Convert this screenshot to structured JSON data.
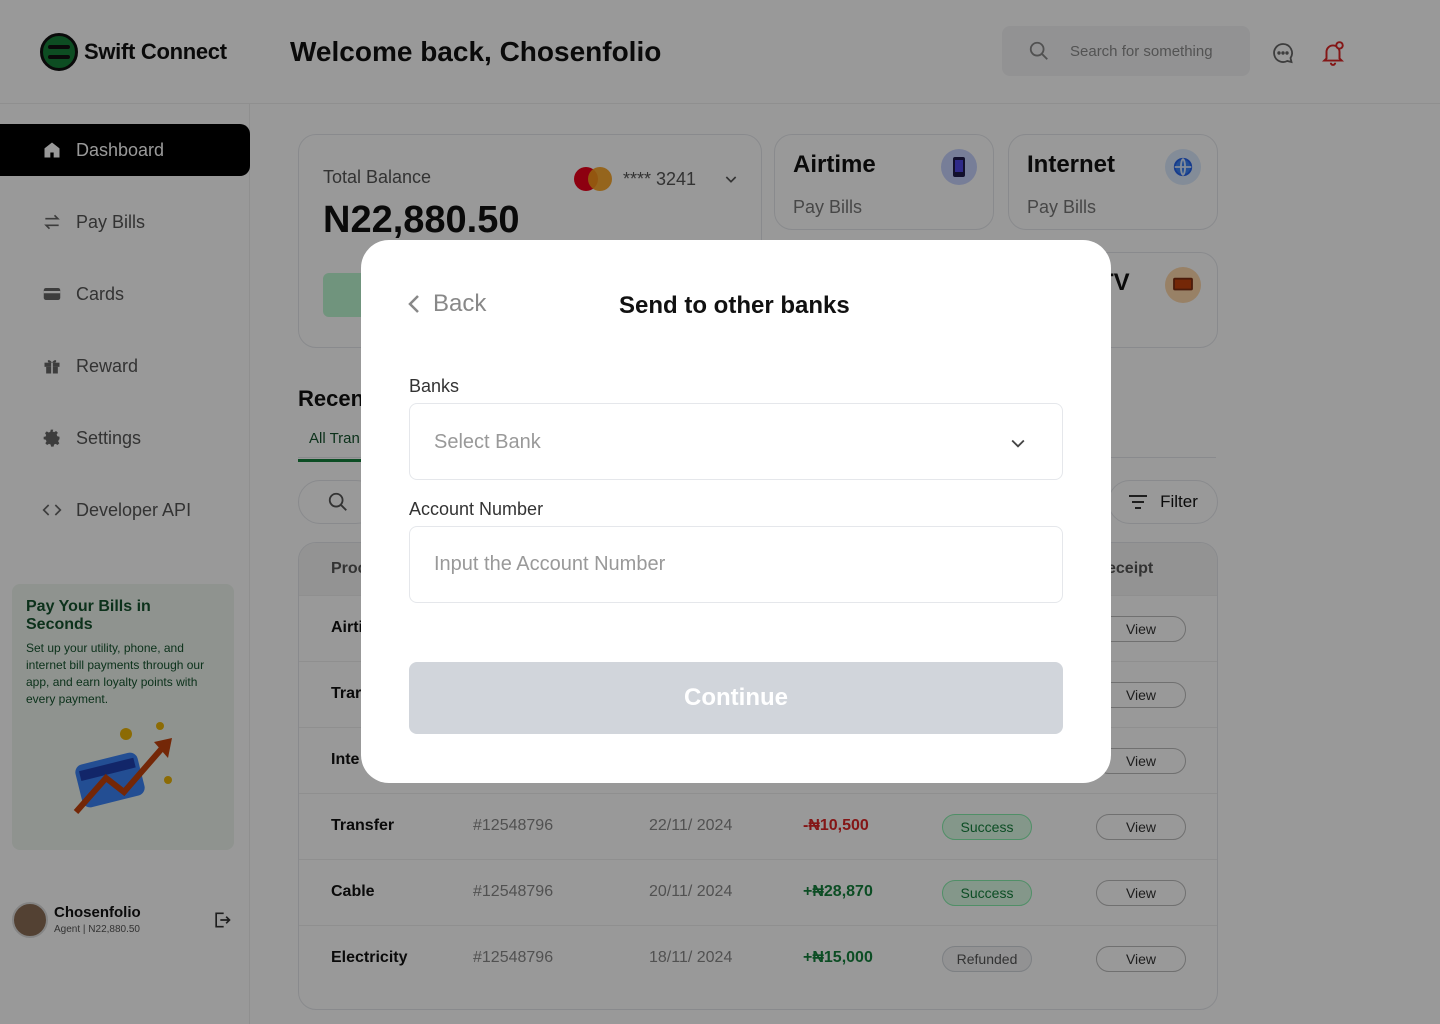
{
  "brand": {
    "name": "Swift Connect"
  },
  "header": {
    "welcome": "Welcome back, Chosenfolio",
    "search_placeholder": "Search for something"
  },
  "sidebar": {
    "items": [
      {
        "label": "Dashboard",
        "icon": "home-icon",
        "active": true
      },
      {
        "label": "Pay Bills",
        "icon": "transfer-arrows-icon"
      },
      {
        "label": "Cards",
        "icon": "credit-card-icon"
      },
      {
        "label": "Reward",
        "icon": "gift-icon"
      },
      {
        "label": "Settings",
        "icon": "gear-icon"
      },
      {
        "label": "Developer API",
        "icon": "code-icon"
      }
    ],
    "promo": {
      "title": "Pay Your Bills in Seconds",
      "body": "Set up your utility, phone, and internet bill payments through our app, and earn loyalty points with every payment."
    },
    "profile": {
      "name": "Chosenfolio",
      "subtitle": "Agent | N22,880.50"
    }
  },
  "balance": {
    "label": "Total Balance",
    "amount": "N22,880.50",
    "card_masked": "**** 3241"
  },
  "services": [
    {
      "title": "Airtime",
      "subtitle": "Pay Bills",
      "icon": "phone-icon"
    },
    {
      "title": "Internet",
      "subtitle": "Pay Bills",
      "icon": "globe-icon"
    },
    {
      "title": "TV",
      "subtitle": "",
      "icon": "tv-icon"
    }
  ],
  "transactions": {
    "title_visible": "Recen",
    "tab_visible": "All Tran",
    "filter_label": "Filter",
    "columns_visible": {
      "product": "Proc",
      "receipt": "eceipt"
    },
    "rows": [
      {
        "product": "Airti",
        "id": "",
        "date": "",
        "amount": "",
        "status": "",
        "view": "View"
      },
      {
        "product": "Trar",
        "id": "",
        "date": "",
        "amount": "",
        "status": "",
        "view": "View"
      },
      {
        "product": "Inte",
        "id": "",
        "date": "",
        "amount": "",
        "status": "",
        "view": "View"
      },
      {
        "product": "Transfer",
        "id": "#12548796",
        "date": "22/11/ 2024",
        "amount": "-₦10,500",
        "sign": "neg",
        "status": "Success",
        "status_kind": "ok",
        "view": "View"
      },
      {
        "product": "Cable",
        "id": "#12548796",
        "date": "20/11/ 2024",
        "amount": "+₦28,870",
        "sign": "pos",
        "status": "Success",
        "status_kind": "ok",
        "view": "View"
      },
      {
        "product": "Electricity",
        "id": "#12548796",
        "date": "18/11/ 2024",
        "amount": "+₦15,000",
        "sign": "pos",
        "status": "Refunded",
        "status_kind": "ref",
        "view": "View"
      }
    ]
  },
  "modal": {
    "back_label": "Back",
    "title": "Send to other banks",
    "banks_label": "Banks",
    "bank_placeholder": "Select Bank",
    "account_label": "Account Number",
    "account_placeholder": "Input the Account Number",
    "continue_label": "Continue"
  },
  "colors": {
    "accent_green": "#15803d",
    "negative": "#dc2626",
    "disabled_button": "#d1d5db"
  }
}
